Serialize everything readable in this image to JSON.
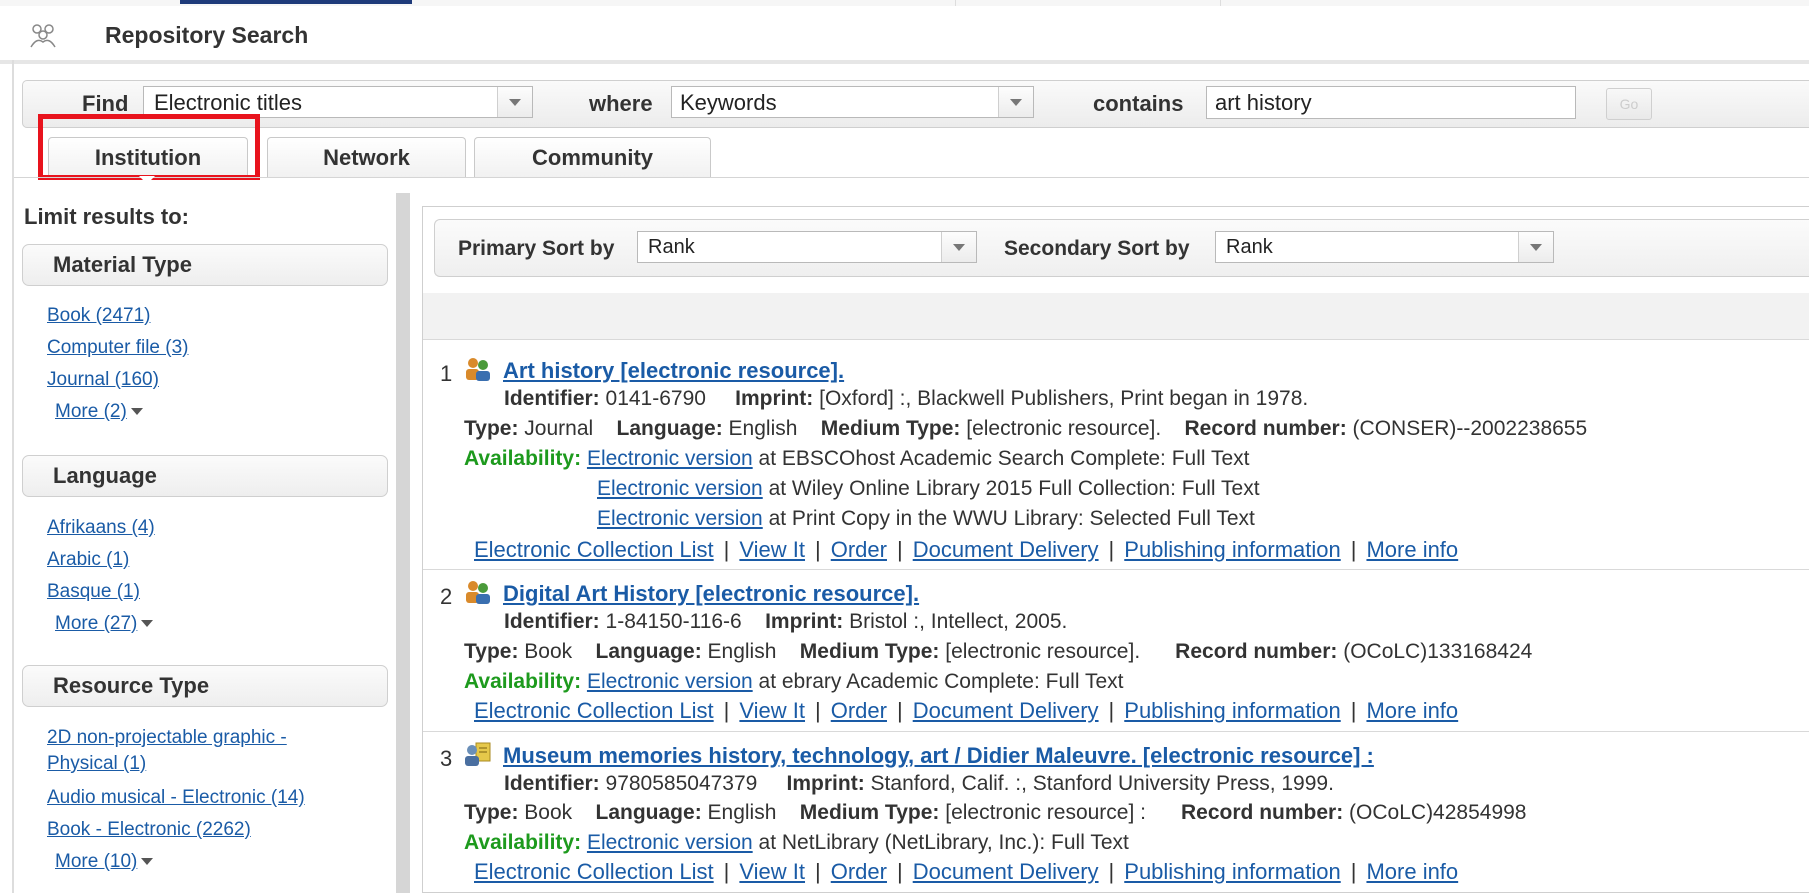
{
  "header": {
    "title": "Repository Search"
  },
  "search": {
    "find_label": "Find",
    "find_value": "Electronic titles",
    "where_label": "where",
    "where_value": "Keywords",
    "contains_label": "contains",
    "query": "art history",
    "go_label": "Go"
  },
  "tabs": [
    {
      "label": "Institution",
      "active": true
    },
    {
      "label": "Network"
    },
    {
      "label": "Community"
    }
  ],
  "facets": {
    "title": "Limit results to:",
    "groups": [
      {
        "heading": "Material Type",
        "items": [
          "Book (2471)",
          "Computer file (3)",
          "Journal (160)"
        ],
        "more": "More (2)"
      },
      {
        "heading": "Language",
        "items": [
          "Afrikaans (4)",
          "Arabic (1)",
          "Basque (1)"
        ],
        "more": "More (27)"
      },
      {
        "heading": "Resource Type",
        "items": [
          "2D non-projectable graphic -",
          "Physical (1)",
          "Audio musical - Electronic (14)",
          "Book - Electronic (2262)"
        ],
        "more": "More (10)"
      }
    ]
  },
  "sort": {
    "primary_label": "Primary Sort by",
    "primary_value": "Rank",
    "secondary_label": "Secondary Sort by",
    "secondary_value": "Rank"
  },
  "labels": {
    "identifier": "Identifier:",
    "imprint": "Imprint:",
    "type": "Type:",
    "language": "Language:",
    "medium": "Medium Type:",
    "record": "Record number:",
    "availability": "Availability:",
    "electronic_version": "Electronic version"
  },
  "actions": [
    "Electronic Collection List",
    "View It",
    "Order",
    "Document Delivery",
    "Publishing information",
    "More info"
  ],
  "results": [
    {
      "num": "1",
      "icon": "journal-icon",
      "title": "Art history [electronic resource].",
      "identifier": "0141-6790",
      "imprint": "[Oxford] :, Blackwell Publishers, Print began in 1978.",
      "type": "Journal",
      "language": "English",
      "medium": "[electronic resource].",
      "record": "(CONSER)--2002238655",
      "availability": [
        "at EBSCOhost Academic Search Complete: Full Text",
        "at Wiley Online Library 2015 Full Collection: Full Text",
        "at Print Copy in the WWU Library: Selected Full Text"
      ]
    },
    {
      "num": "2",
      "icon": "journal-icon",
      "title": "Digital Art History [electronic resource].",
      "identifier": "1-84150-116-6",
      "imprint": "Bristol :, Intellect, 2005.",
      "type": "Book",
      "language": "English",
      "medium": "[electronic resource].",
      "record": "(OCoLC)133168424",
      "availability": [
        "at ebrary Academic Complete: Full Text"
      ]
    },
    {
      "num": "3",
      "icon": "book-icon",
      "title": "Museum memories history, technology, art / Didier Maleuvre. [electronic resource] :",
      "identifier": "9780585047379",
      "imprint": "Stanford, Calif. :, Stanford University Press, 1999.",
      "type": "Book",
      "language": "English",
      "medium": "[electronic resource] :",
      "record": "(OCoLC)42854998",
      "availability": [
        "at NetLibrary (NetLibrary, Inc.): Full Text"
      ]
    }
  ]
}
